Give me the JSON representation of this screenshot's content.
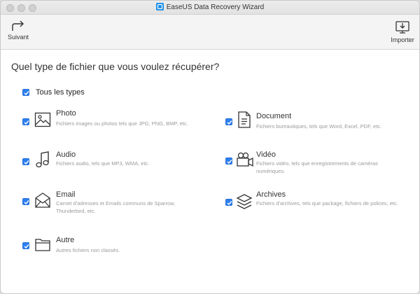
{
  "window": {
    "title": "EaseUS Data Recovery Wizard"
  },
  "toolbar": {
    "next_label": "Suivant",
    "import_label": "Importer"
  },
  "question": "Quel type de fichier que vous voulez récupérer?",
  "all_types": {
    "label": "Tous les types",
    "checked": true
  },
  "types": [
    {
      "title": "Photo",
      "desc": "Fichiers images ou photos tels que JPG, PNG, BMP, etc.",
      "icon": "photo-icon",
      "checked": true
    },
    {
      "title": "Document",
      "desc": "Fichiers bureautiques, tels que Word, Excel, PDF, etc.",
      "icon": "document-icon",
      "checked": true
    },
    {
      "title": "Audio",
      "desc": "Fichiers audio, tels que MP3, WMA, etc.",
      "icon": "music-note-icon",
      "checked": true
    },
    {
      "title": "Vidéo",
      "desc": "Fichiers vidéo, tels que enregistrements de caméras numériques.",
      "icon": "video-camera-icon",
      "checked": true
    },
    {
      "title": "Email",
      "desc": "Carnet d'adresses et Emails communs de Sparrow, Thunderbird, etc.",
      "icon": "envelope-icon",
      "checked": true
    },
    {
      "title": "Archives",
      "desc": "Fichiers d'archives, tels que package, fichiers de polices, etc.",
      "icon": "layers-icon",
      "checked": true
    },
    {
      "title": "Autre",
      "desc": "Autres fichiers non classés.",
      "icon": "folder-icon",
      "checked": true
    }
  ],
  "colors": {
    "checkbox": "#2e7ff0",
    "toolbar_bg": "#f4f4f4",
    "desc_text": "#9a9a9a"
  }
}
